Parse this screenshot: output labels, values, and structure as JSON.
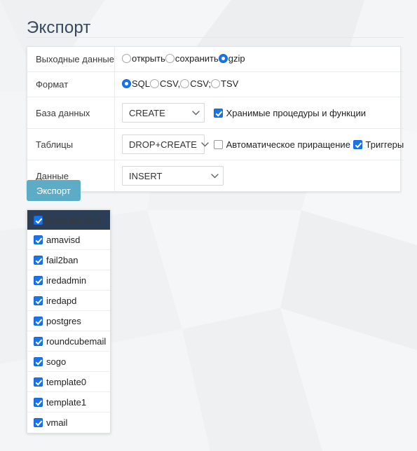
{
  "page": {
    "title": "Экспорт",
    "accent_button_color": "#5cacc8",
    "accent_checkbox_color": "#1a73e8",
    "header_bar_color": "#2c3e56",
    "title_color": "#37475c"
  },
  "form": {
    "rows": [
      {
        "label": "Выходные данные",
        "type": "radio",
        "options": [
          {
            "label": "открыть",
            "checked": false
          },
          {
            "label": "сохранить",
            "checked": false
          },
          {
            "label": "gzip",
            "checked": true
          }
        ]
      },
      {
        "label": "Формат",
        "type": "radio",
        "options": [
          {
            "label": "SQL",
            "checked": true
          },
          {
            "label": "CSV,",
            "checked": false
          },
          {
            "label": "CSV;",
            "checked": false
          },
          {
            "label": "TSV",
            "checked": false
          }
        ]
      },
      {
        "label": "База данных",
        "type": "select-checkbox",
        "select": {
          "value": "CREATE",
          "icon": "chevron-down-icon"
        },
        "checkboxes": [
          {
            "label": "Хранимые процедуры и функции",
            "checked": true
          }
        ]
      },
      {
        "label": "Таблицы",
        "type": "select-checkbox",
        "select": {
          "value": "DROP+CREATE",
          "icon": "chevron-down-icon"
        },
        "checkboxes": [
          {
            "label": "Автоматическое приращение",
            "checked": false
          },
          {
            "label": "Триггеры",
            "checked": true
          }
        ]
      },
      {
        "label": "Данные",
        "type": "select",
        "select": {
          "value": "INSERT",
          "icon": "chevron-down-icon"
        }
      }
    ]
  },
  "actions": {
    "export_button": "Экспорт"
  },
  "database_list": {
    "header": {
      "label": "База данных",
      "checked": true
    },
    "items": [
      {
        "label": "amavisd",
        "checked": true
      },
      {
        "label": "fail2ban",
        "checked": true
      },
      {
        "label": "iredadmin",
        "checked": true
      },
      {
        "label": "iredapd",
        "checked": true
      },
      {
        "label": "postgres",
        "checked": true
      },
      {
        "label": "roundcubemail",
        "checked": true
      },
      {
        "label": "sogo",
        "checked": true
      },
      {
        "label": "template0",
        "checked": true
      },
      {
        "label": "template1",
        "checked": true
      },
      {
        "label": "vmail",
        "checked": true
      }
    ]
  }
}
